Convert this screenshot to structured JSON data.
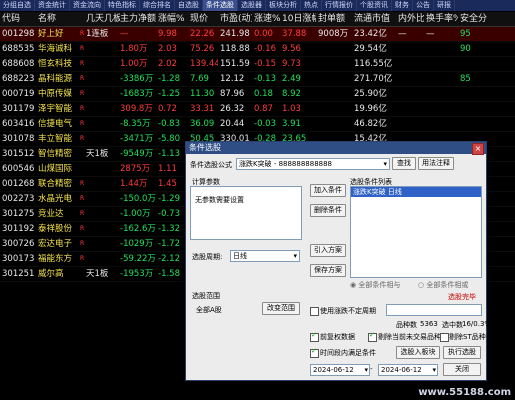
{
  "nav": {
    "tabs": [
      "分组自选",
      "资金统计",
      "资金流向",
      "特色指标",
      "综合排名",
      "自选股",
      "条件选股",
      "选股器",
      "板块分析",
      "热点",
      "行情报价",
      "个股资讯",
      "财务",
      "公告",
      "研报"
    ]
  },
  "table": {
    "headers": [
      "代码",
      "名称",
      "几天几板",
      "主力净额",
      "涨幅%",
      "现价",
      "市盈(动)",
      "涨速%",
      "10日涨幅%",
      "封单额",
      "流通市值",
      "内外比",
      "换手率%",
      "安全分"
    ],
    "rows": [
      {
        "code": "001298",
        "name": "好上好",
        "flag": "R",
        "days": "1连板",
        "net": "—",
        "chg": "9.98",
        "price": "22.26",
        "pe": "241.98",
        "spd": "0.00",
        "chg10": "37.88",
        "seal": "9008万",
        "cap": "23.42亿",
        "ratio": "—",
        "turn": "—",
        "score": "95",
        "c": "red",
        "sel": true
      },
      {
        "code": "688535",
        "name": "华海诚科",
        "flag": "R",
        "days": "",
        "net": "1.80万",
        "chg": "2.03",
        "price": "75.26",
        "pe": "118.88",
        "spd": "-0.16",
        "chg10": "9.56",
        "seal": "",
        "cap": "29.54亿",
        "ratio": "",
        "turn": "",
        "score": "90",
        "c": "red"
      },
      {
        "code": "688608",
        "name": "恒玄科技",
        "flag": "R",
        "days": "",
        "net": "1.00万",
        "chg": "2.02",
        "price": "139.44",
        "pe": "151.59",
        "spd": "-0.15",
        "chg10": "9.73",
        "seal": "",
        "cap": "116.55亿",
        "ratio": "",
        "turn": "",
        "score": "",
        "c": "red"
      },
      {
        "code": "688223",
        "name": "晶科能源",
        "flag": "R",
        "days": "",
        "net": "-3386万",
        "chg": "-1.28",
        "price": "7.69",
        "pe": "12.12",
        "spd": "-0.13",
        "chg10": "2.49",
        "seal": "",
        "cap": "271.70亿",
        "ratio": "",
        "turn": "",
        "score": "85",
        "c": "green"
      },
      {
        "code": "000719",
        "name": "中原传媒",
        "flag": "R",
        "days": "",
        "net": "-1683万",
        "chg": "-1.25",
        "price": "11.30",
        "pe": "87.96",
        "spd": "0.18",
        "chg10": "8.92",
        "seal": "",
        "cap": "25.90亿",
        "ratio": "",
        "turn": "",
        "score": "",
        "c": "green"
      },
      {
        "code": "301179",
        "name": "泽宇智能",
        "flag": "R",
        "days": "",
        "net": "309.8万",
        "chg": "0.72",
        "price": "33.31",
        "pe": "26.32",
        "spd": "0.87",
        "chg10": "1.03",
        "seal": "",
        "cap": "19.96亿",
        "ratio": "",
        "turn": "",
        "score": "",
        "c": "red"
      },
      {
        "code": "603416",
        "name": "信捷电气",
        "flag": "R",
        "days": "",
        "net": "-8.35万",
        "chg": "-0.83",
        "price": "36.09",
        "pe": "20.44",
        "spd": "-0.03",
        "chg10": "3.91",
        "seal": "",
        "cap": "46.82亿",
        "ratio": "",
        "turn": "",
        "score": "",
        "c": "green"
      },
      {
        "code": "301078",
        "name": "丰立智能",
        "flag": "R",
        "days": "",
        "net": "-3471万",
        "chg": "-5.80",
        "price": "50.45",
        "pe": "330.01",
        "spd": "-0.28",
        "chg10": "23.65",
        "seal": "",
        "cap": "15.42亿",
        "ratio": "",
        "turn": "",
        "score": "",
        "c": "green"
      },
      {
        "code": "301512",
        "name": "智信精密",
        "flag": "",
        "days": "天1板",
        "net": "-9549万",
        "chg": "-1.13",
        "price": "51.40",
        "pe": "",
        "spd": "-0.06",
        "chg10": "14.09",
        "seal": "",
        "cap": "14.63亿",
        "ratio": "",
        "turn": "",
        "score": "",
        "c": "green"
      },
      {
        "code": "600546",
        "name": "山煤国际",
        "flag": "",
        "days": "",
        "net": "2875万",
        "chg": "1.11",
        "price": "",
        "pe": "",
        "spd": "",
        "chg10": "",
        "seal": "",
        "cap": "",
        "ratio": "",
        "turn": "",
        "score": "",
        "c": "red"
      },
      {
        "code": "001268",
        "name": "联合精密",
        "flag": "R",
        "days": "",
        "net": "1.44万",
        "chg": "1.45",
        "price": "",
        "pe": "",
        "spd": "",
        "chg10": "",
        "seal": "",
        "cap": "",
        "ratio": "",
        "turn": "",
        "score": "",
        "c": "red"
      },
      {
        "code": "002273",
        "name": "水晶光电",
        "flag": "R",
        "days": "",
        "net": "-150.0万",
        "chg": "-1.29",
        "price": "",
        "pe": "",
        "spd": "",
        "chg10": "",
        "seal": "",
        "cap": "",
        "ratio": "",
        "turn": "",
        "score": "",
        "c": "green"
      },
      {
        "code": "301275",
        "name": "竞业达",
        "flag": "R",
        "days": "",
        "net": "-1.00万",
        "chg": "-0.73",
        "price": "",
        "pe": "",
        "spd": "",
        "chg10": "",
        "seal": "",
        "cap": "",
        "ratio": "",
        "turn": "",
        "score": "",
        "c": "green"
      },
      {
        "code": "301192",
        "name": "泰祥股份",
        "flag": "R",
        "days": "",
        "net": "-162.6万",
        "chg": "-1.32",
        "price": "",
        "pe": "",
        "spd": "",
        "chg10": "",
        "seal": "",
        "cap": "",
        "ratio": "",
        "turn": "",
        "score": "",
        "c": "green"
      },
      {
        "code": "300726",
        "name": "宏达电子",
        "flag": "R",
        "days": "",
        "net": "-1029万",
        "chg": "-1.72",
        "price": "",
        "pe": "",
        "spd": "",
        "chg10": "",
        "seal": "",
        "cap": "",
        "ratio": "",
        "turn": "",
        "score": "",
        "c": "green"
      },
      {
        "code": "300173",
        "name": "福能东方",
        "flag": "R",
        "days": "",
        "net": "-59.22万",
        "chg": "-2.12",
        "price": "",
        "pe": "",
        "spd": "",
        "chg10": "",
        "seal": "",
        "cap": "",
        "ratio": "",
        "turn": "",
        "score": "",
        "c": "green"
      },
      {
        "code": "301251",
        "name": "威尔高",
        "flag": "",
        "days": "天1板",
        "net": "-1953万",
        "chg": "-1.58",
        "price": "",
        "pe": "",
        "spd": "",
        "chg10": "",
        "seal": "",
        "cap": "",
        "ratio": "",
        "turn": "",
        "score": "",
        "c": "green"
      }
    ]
  },
  "dialog": {
    "title": "条件选股",
    "formula_label": "条件选股公式",
    "formula_value": "涨跌K突破 - 888888888888",
    "find_btn": "查找",
    "usage_btn": "用法注释",
    "params_title": "计算参数",
    "params_empty": "无参数需要设置",
    "add_btn": "加入条件",
    "del_btn": "删除条件",
    "cond_list_title": "选股条件列表",
    "cond_item": "涨跌K突破 日线",
    "import_btn": "引入方案",
    "save_btn": "保存方案",
    "period_label": "选股周期:",
    "period_value": "日线",
    "radio_all": "全部条件相与",
    "radio_any": "全部条件相或",
    "done_text": "选股完毕",
    "scope_title": "选股范围",
    "scope_value": "全部A股",
    "change_scope_btn": "改变范围",
    "use_custom_label": "使用涨跌不定周期",
    "count_label": "品种数",
    "count_value": "5363",
    "hit_label": "选中数",
    "hit_value": "16/0.3%",
    "fq_label": "前复权数据",
    "excl_label": "剔除当前未交易品种",
    "excl_st_label": "剔除ST品种",
    "time_label": "时间段内满足条件",
    "to_board_btn": "选股入板块",
    "exec_btn": "执行选股",
    "date_from": "2024-06-12",
    "date_to": "2024-06-12",
    "close_btn": "关闭"
  },
  "watermark": "www.55188.com"
}
